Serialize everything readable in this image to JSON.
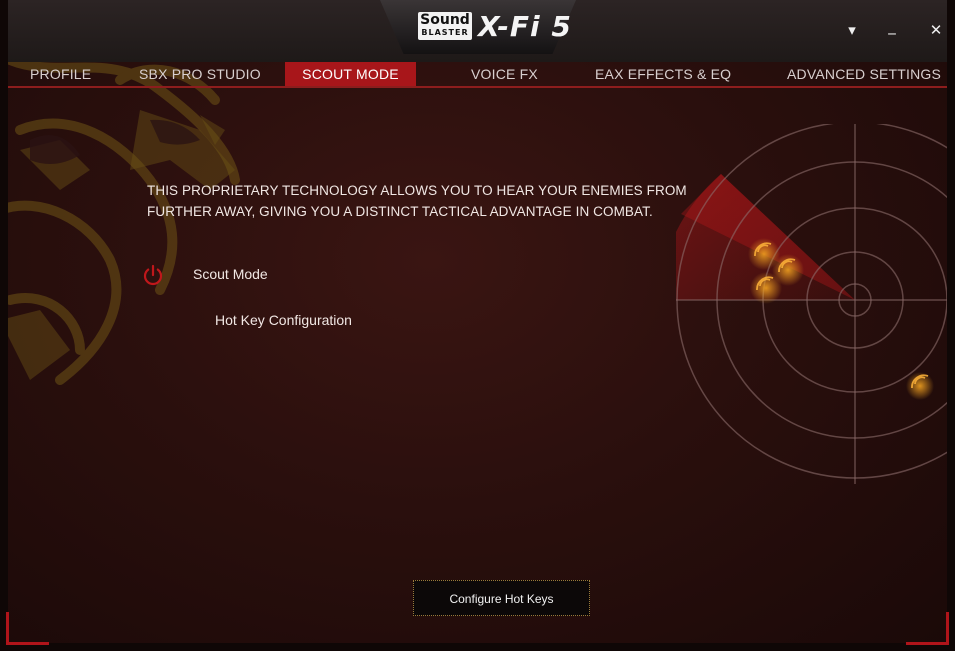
{
  "titlebar": {
    "logo_sound": "Sound",
    "logo_blaster": "BLASTER",
    "logo_product": "X-Fi 5",
    "dropdown_glyph": "▾",
    "minimize_glyph": "_",
    "close_glyph": "✕"
  },
  "tabs": [
    {
      "label": "PROFILE"
    },
    {
      "label": "SBX PRO STUDIO"
    },
    {
      "label": "SCOUT MODE",
      "active": true
    },
    {
      "label": "VOICE FX"
    },
    {
      "label": "EAX EFFECTS & EQ"
    },
    {
      "label": "ADVANCED SETTINGS"
    }
  ],
  "scout": {
    "description": "THIS PROPRIETARY TECHNOLOGY ALLOWS YOU TO HEAR YOUR ENEMIES FROM FURTHER AWAY, GIVING YOU A DISTINCT TACTICAL ADVANTAGE IN COMBAT.",
    "toggle_label": "Scout Mode",
    "toggle_state": "off",
    "hotkey_label": "Hot Key Configuration",
    "configure_button": "Configure Hot Keys"
  },
  "colors": {
    "accent": "#a8161a",
    "power_icon": "#c0171b",
    "gold": "#c9962f"
  },
  "icons": {
    "power": "power-icon",
    "dropdown": "chevron-down-icon",
    "minimize": "minimize-icon",
    "close": "close-icon",
    "radar": "radar-icon",
    "dragon": "dragon-logo"
  }
}
